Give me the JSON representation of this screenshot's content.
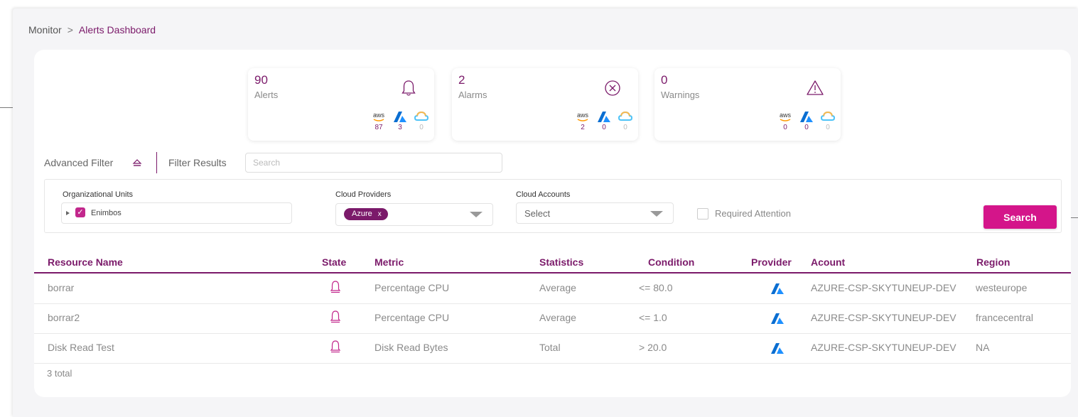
{
  "breadcrumb": {
    "root": "Monitor",
    "separator": ">",
    "current": "Alerts Dashboard"
  },
  "stats": [
    {
      "value": "90",
      "label": "Alerts",
      "icon": "bell-icon",
      "counts": {
        "aws": "87",
        "azure": "3",
        "gcp": "0"
      }
    },
    {
      "value": "2",
      "label": "Alarms",
      "icon": "circle-x-icon",
      "counts": {
        "aws": "2",
        "azure": "0",
        "gcp": "0"
      }
    },
    {
      "value": "0",
      "label": "Warnings",
      "icon": "warning-triangle-icon",
      "counts": {
        "aws": "0",
        "azure": "0",
        "gcp": "0"
      }
    }
  ],
  "provider_logo_text": {
    "aws": "aws"
  },
  "filter": {
    "advanced_label": "Advanced Filter",
    "results_label": "Filter Results",
    "search_placeholder": "Search"
  },
  "filters": {
    "org_units": {
      "label": "Organizational Units",
      "value": "Enimbos"
    },
    "cloud_providers": {
      "label": "Cloud Providers",
      "chip": "Azure",
      "chip_remove": "x"
    },
    "cloud_accounts": {
      "label": "Cloud Accounts",
      "value": "Select"
    },
    "required_attention": {
      "label": "Required Attention",
      "checked": false
    },
    "search_button": "Search"
  },
  "table": {
    "headers": {
      "resource_name": "Resource Name",
      "state": "State",
      "metric": "Metric",
      "statistics": "Statistics",
      "condition": "Condition",
      "provider": "Provider",
      "account": "Acount",
      "region": "Region"
    },
    "rows": [
      {
        "resource_name": "borrar",
        "state": "bell-icon",
        "metric": "Percentage CPU",
        "statistics": "Average",
        "condition": "<= 80.0",
        "provider": "azure-icon",
        "account": "AZURE-CSP-SKYTUNEUP-DEV",
        "region": "westeurope"
      },
      {
        "resource_name": "borrar2",
        "state": "bell-icon",
        "metric": "Percentage CPU",
        "statistics": "Average",
        "condition": "<= 1.0",
        "provider": "azure-icon",
        "account": "AZURE-CSP-SKYTUNEUP-DEV",
        "region": "francecentral"
      },
      {
        "resource_name": "Disk Read Test",
        "state": "bell-icon",
        "metric": "Disk Read Bytes",
        "statistics": "Total",
        "condition": "> 20.0",
        "provider": "azure-icon",
        "account": "AZURE-CSP-SKYTUNEUP-DEV",
        "region": "NA"
      }
    ],
    "total": "3 total"
  },
  "colors": {
    "brand": "#7b1a6a",
    "accent": "#d4158a",
    "aws_orange": "#f90",
    "azure_blue": "#0a6ed1",
    "gcp_gradient": [
      "#f8b84e",
      "#4fc3f7"
    ]
  }
}
